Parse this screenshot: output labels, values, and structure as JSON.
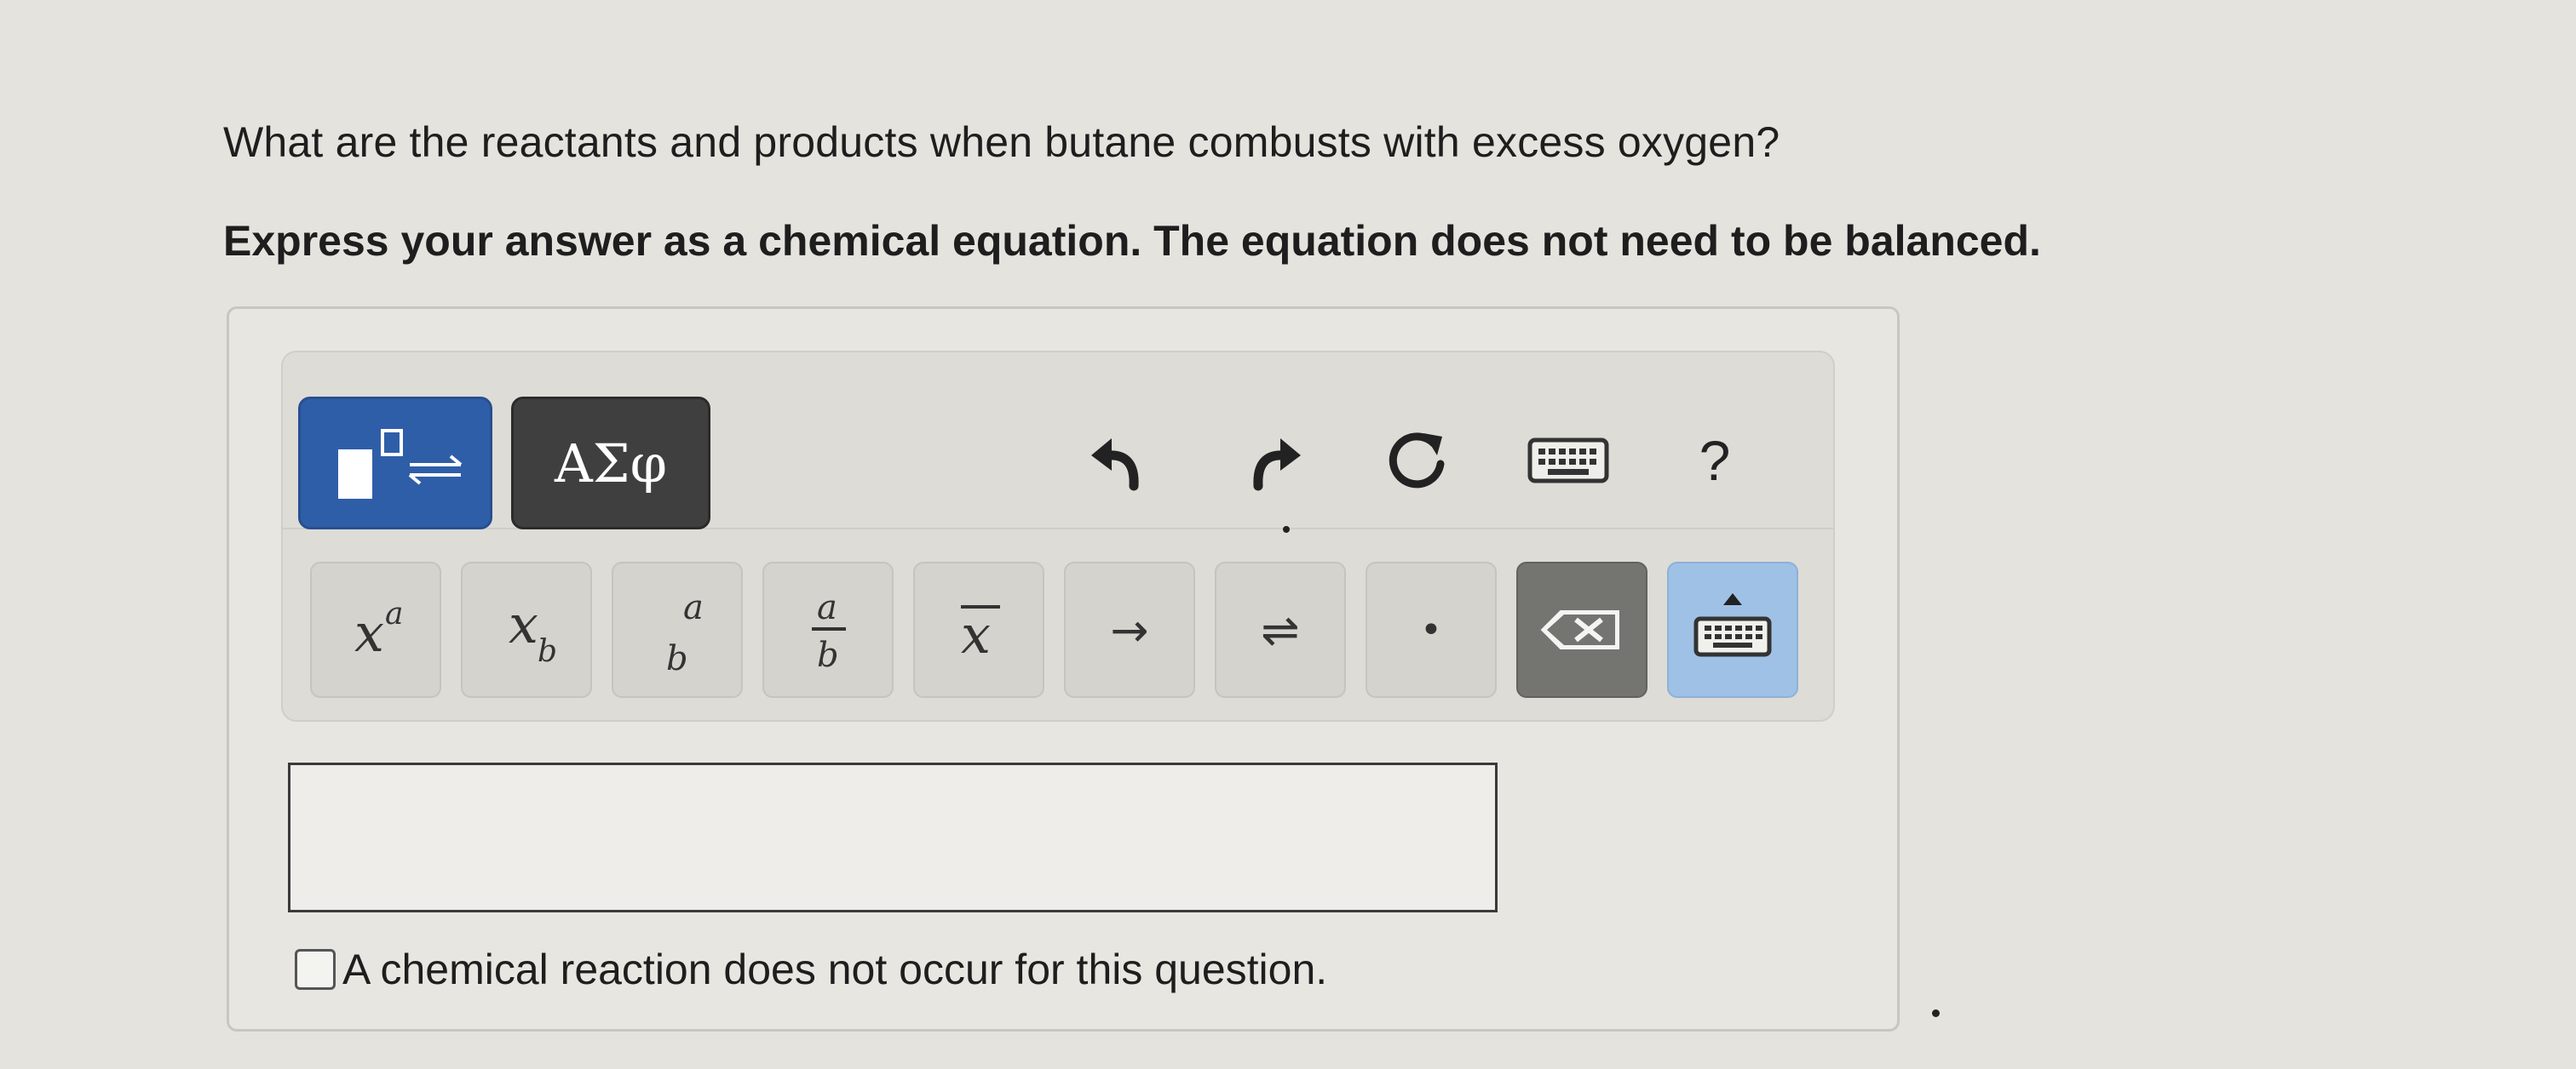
{
  "question": {
    "text": "What are the reactants and products when butane combusts with excess oxygen?",
    "instruction": "Express your answer as a chemical equation. The equation does not need to be balanced."
  },
  "toolbar": {
    "tabs": [
      {
        "name": "templates",
        "icon": "templates-icon",
        "selected": true
      },
      {
        "name": "symbols",
        "label": "ΑΣφ",
        "selected": false
      }
    ],
    "actions": [
      {
        "name": "undo",
        "icon": "undo-icon"
      },
      {
        "name": "redo",
        "icon": "redo-icon"
      },
      {
        "name": "reset",
        "icon": "reset-icon"
      },
      {
        "name": "keyboard-shortcuts",
        "icon": "keyboard-icon"
      },
      {
        "name": "help",
        "label": "?",
        "icon": "help-icon"
      }
    ],
    "keys": [
      {
        "name": "superscript",
        "icon": "superscript-icon"
      },
      {
        "name": "subscript",
        "icon": "subscript-icon"
      },
      {
        "name": "stacked-fraction",
        "icon": "stacked-fraction-icon"
      },
      {
        "name": "fraction",
        "icon": "fraction-icon"
      },
      {
        "name": "overbar",
        "icon": "overbar-icon"
      },
      {
        "name": "reaction-arrow",
        "label": "→",
        "icon": "reaction-arrow-icon"
      },
      {
        "name": "equilibrium-arrow",
        "label": "⇌",
        "icon": "equilibrium-arrow-icon"
      },
      {
        "name": "dot",
        "label": "•",
        "icon": "dot-icon"
      },
      {
        "name": "delete",
        "icon": "backspace-icon"
      },
      {
        "name": "show-keyboard",
        "icon": "keyboard-toggle-icon"
      }
    ]
  },
  "answer": {
    "value": "",
    "placeholder": ""
  },
  "no_reaction": {
    "label": "A chemical reaction does not occur for this question.",
    "checked": false
  },
  "colors": {
    "background": "#e4e3de",
    "templates_tab": "#2f5ea8",
    "symbols_tab": "#3f3f3f",
    "delete_key": "#747470",
    "keyboard_key": "#9fc1e6"
  }
}
